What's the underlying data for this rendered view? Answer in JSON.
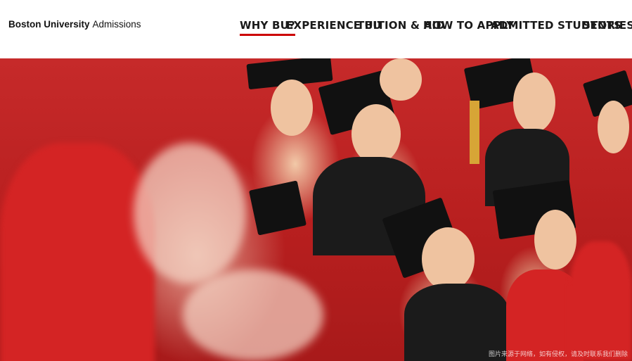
{
  "header": {
    "brand_strong": "Boston University",
    "brand_light": "Admissions"
  },
  "nav": {
    "items": [
      {
        "label": "WHY BU?",
        "active": true
      },
      {
        "label": "EXPERIENCE BU",
        "active": false
      },
      {
        "label": "TUITION & AID",
        "active": false
      },
      {
        "label": "HOW TO APPLY",
        "active": false
      },
      {
        "label": "ADMITTED STUDENTS",
        "active": false
      },
      {
        "label": "STORIES",
        "active": false
      }
    ]
  },
  "hero": {
    "watermark": "图片来源于网络，如有侵权，请及时联系我们删除"
  },
  "colors": {
    "accent": "#cc0000",
    "text": "#1a1a1a",
    "background": "#ffffff"
  }
}
